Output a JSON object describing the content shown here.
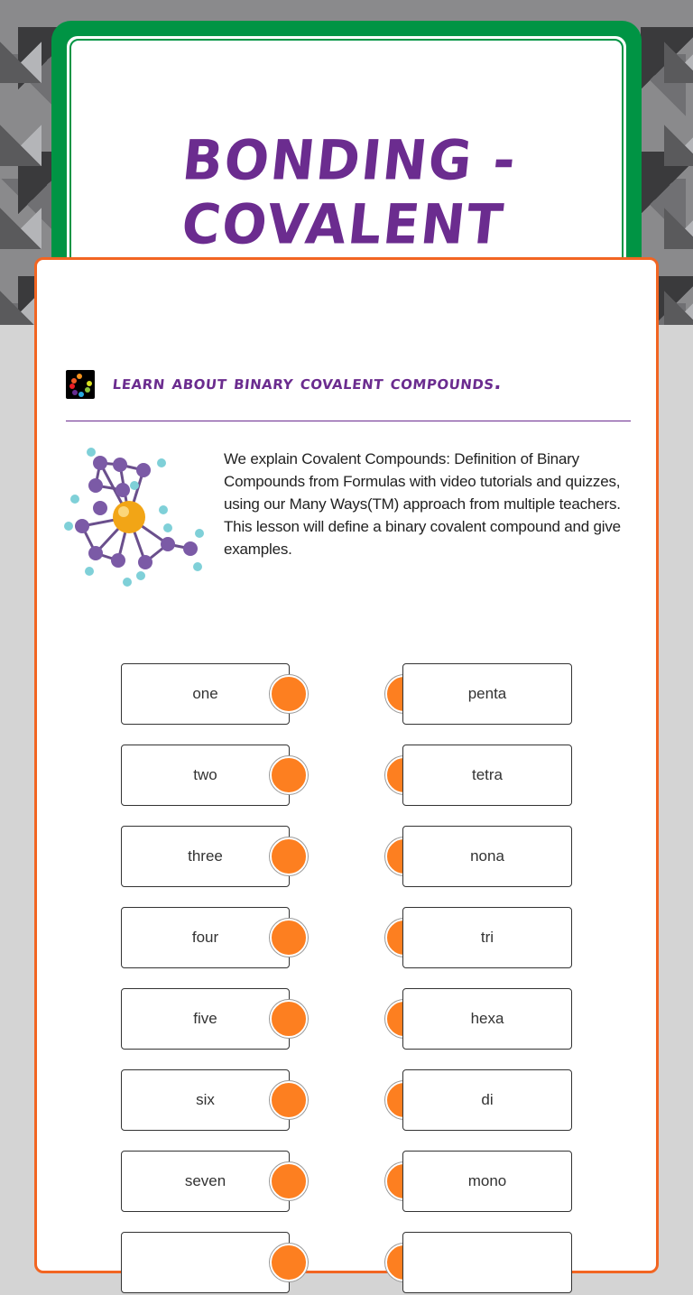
{
  "header": {
    "title": "BONDING - COVALENT"
  },
  "section": {
    "icon": "spinner-logo-icon",
    "title": "Learn about binary covalent compounds.",
    "image": "molecule-icon",
    "description": [
      "We explain Covalent Compounds: Definition of Binary Compounds from Formulas with video tutorials and quizzes, using our Many Ways(TM) approach from multiple teachers.",
      "This lesson will define a binary covalent compound and give examples."
    ]
  },
  "matching": {
    "left": [
      "one",
      "two",
      "three",
      "four",
      "five",
      "six",
      "seven",
      ""
    ],
    "right": [
      "penta",
      "tetra",
      "nona",
      "tri",
      "hexa",
      "di",
      "mono",
      ""
    ]
  },
  "colors": {
    "title_purple": "#6b2c8f",
    "header_green": "#009444",
    "card_orange": "#f26522",
    "dot_orange": "#fd7f20"
  }
}
